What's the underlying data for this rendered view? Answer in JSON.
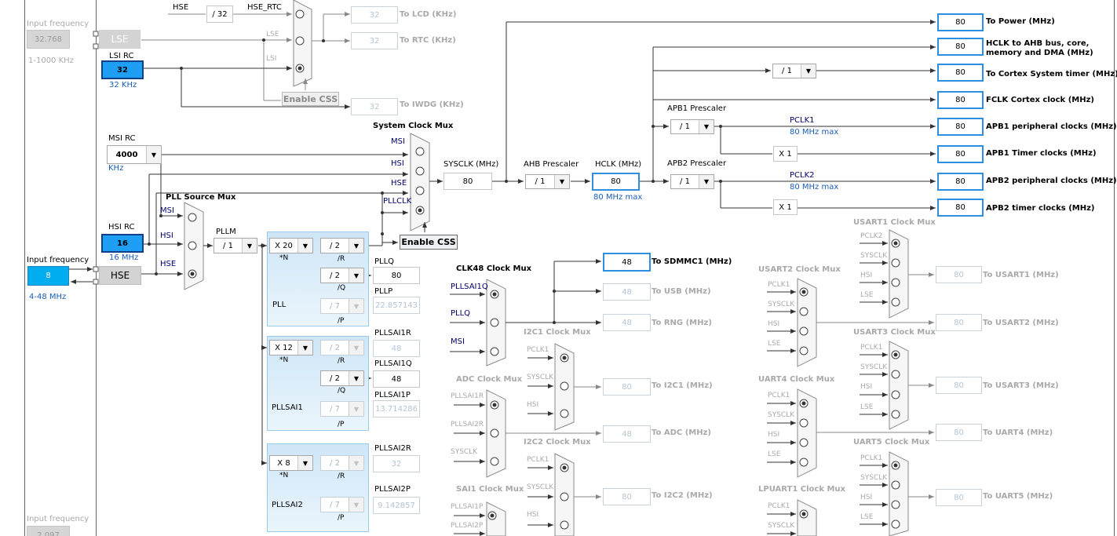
{
  "left_panel": {
    "input_frequency_label": "Input frequency",
    "lse_input_value": "32.768",
    "lse_range": "1-1000 KHz",
    "lse_label": "LSE",
    "lsi_label": "LSI RC",
    "lsi_value": "32",
    "lsi_unit": "32 KHz",
    "msi_label": "MSI RC",
    "msi_value": "4000",
    "msi_unit": "KHz",
    "hsi_label": "HSI RC",
    "hsi_value": "16",
    "hsi_unit": "16 MHz",
    "hse_input_value": "8",
    "hse_range": "4-48 MHz",
    "hse_label": "HSE",
    "bottom_input_value": "2.097"
  },
  "rtc": {
    "hse_label": "HSE",
    "hse_div": "/ 32",
    "hse_rtc_label": "HSE_RTC",
    "lse_label": "LSE",
    "lsi_label": "LSI",
    "enable_css": "Enable CSS",
    "lcd_value": "32",
    "lcd_label": "To LCD (KHz)",
    "rtc_value": "32",
    "rtc_label": "To RTC (KHz)",
    "iwdg_value": "32",
    "iwdg_label": "To IWDG (KHz)"
  },
  "system": {
    "mux_title": "System Clock Mux",
    "msi": "MSI",
    "hsi": "HSI",
    "hse": "HSE",
    "pllclk": "PLLCLK",
    "enable_css": "Enable CSS",
    "sysclk_label": "SYSCLK (MHz)",
    "sysclk_value": "80",
    "ahb_label": "AHB Prescaler",
    "ahb_value": "/ 1",
    "hclk_label": "HCLK (MHz)",
    "hclk_value": "80",
    "hclk_max": "80 MHz max",
    "cortex_div": "/ 1",
    "apb1_label": "APB1 Prescaler",
    "apb1_value": "/ 1",
    "pclk1_label": "PCLK1",
    "pclk1_max": "80 MHz max",
    "apb1_timer_mult": "X 1",
    "apb2_label": "APB2 Prescaler",
    "apb2_value": "/ 1",
    "pclk2_label": "PCLK2",
    "pclk2_max": "80 MHz max",
    "apb2_timer_mult": "X 1"
  },
  "outputs": [
    {
      "value": "80",
      "label": "To Power (MHz)"
    },
    {
      "value": "80",
      "label": "HCLK to AHB bus, core,",
      "label2": "memory and DMA (MHz)"
    },
    {
      "value": "80",
      "label": "To Cortex System timer (MHz)"
    },
    {
      "value": "80",
      "label": "FCLK Cortex clock (MHz)"
    },
    {
      "value": "80",
      "label": "APB1 peripheral clocks (MHz)"
    },
    {
      "value": "80",
      "label": "APB1 Timer clocks (MHz)"
    },
    {
      "value": "80",
      "label": "APB2 peripheral clocks (MHz)"
    },
    {
      "value": "80",
      "label": "APB2 timer clocks (MHz)"
    }
  ],
  "pll": {
    "source_mux_title": "PLL Source Mux",
    "msi": "MSI",
    "hsi": "HSI",
    "hse": "HSE",
    "pllm_label": "PLLM",
    "pllm_value": "/ 1",
    "main": {
      "n": "X 20",
      "n_label": "*N",
      "r": "/ 2",
      "r_label": "/R",
      "q": "/ 2",
      "q_label": "/Q",
      "p": "/ 7",
      "p_label": "/P",
      "name": "PLL",
      "pllq_label": "PLLQ",
      "pllq_value": "80",
      "pllp_label": "PLLP",
      "pllp_value": "22.857143"
    },
    "sai1": {
      "n": "X 12",
      "n_label": "*N",
      "r": "/ 2",
      "r_label": "/R",
      "q": "/ 2",
      "q_label": "/Q",
      "p": "/ 7",
      "p_label": "/P",
      "name": "PLLSAI1",
      "r_out_label": "PLLSAI1R",
      "r_out_value": "48",
      "q_out_label": "PLLSAI1Q",
      "q_out_value": "48",
      "p_out_label": "PLLSAI1P",
      "p_out_value": "13.714286"
    },
    "sai2": {
      "n": "X 8",
      "n_label": "*N",
      "r": "/ 2",
      "r_label": "/R",
      "p": "/ 7",
      "p_label": "/P",
      "name": "PLLSAI2",
      "r_out_label": "PLLSAI2R",
      "r_out_value": "32",
      "p_out_label": "PLLSAI2P",
      "p_out_value": "9.142857"
    }
  },
  "clk48": {
    "title": "CLK48 Clock Mux",
    "in1": "PLLSAI1Q",
    "in2": "PLLQ",
    "in3": "MSI",
    "sdmmc_value": "48",
    "sdmmc_label": "To SDMMC1 (MHz)",
    "usb_value": "48",
    "usb_label": "To USB (MHz)",
    "rng_value": "48",
    "rng_label": "To RNG (MHz)"
  },
  "i2c1": {
    "title": "I2C1 Clock Mux",
    "in1": "PCLK1",
    "in2": "SYSCLK",
    "in3": "HSI",
    "value": "80",
    "label": "To I2C1 (MHz)"
  },
  "adc": {
    "title": "ADC Clock Mux",
    "in1": "PLLSAI1R",
    "in2": "PLLSAI2R",
    "in3": "SYSCLK",
    "value": "48",
    "label": "To ADC (MHz)"
  },
  "i2c2": {
    "title": "I2C2 Clock Mux",
    "in1": "PCLK1",
    "in2": "SYSCLK",
    "in3": "HSI",
    "value": "80",
    "label": "To I2C2 (MHz)"
  },
  "sai1": {
    "title": "SAI1 Clock Mux",
    "in1": "PLLSAI1P",
    "in2": "PLLSAI2P"
  },
  "usart1": {
    "title": "USART1 Clock Mux",
    "in1": "PCLK2",
    "in2": "SYSCLK",
    "in3": "HSI",
    "in4": "LSE",
    "value": "80",
    "label": "To USART1 (MHz)"
  },
  "usart2": {
    "title": "USART2 Clock Mux",
    "in1": "PCLK1",
    "in2": "SYSCLK",
    "in3": "HSI",
    "in4": "LSE",
    "value": "80",
    "label": "To USART2 (MHz)"
  },
  "usart3": {
    "title": "USART3 Clock Mux",
    "in1": "PCLK1",
    "in2": "SYSCLK",
    "in3": "HSI",
    "in4": "LSE",
    "value": "80",
    "label": "To USART3 (MHz)"
  },
  "uart4": {
    "title": "UART4 Clock Mux",
    "in1": "PCLK1",
    "in2": "SYSCLK",
    "in3": "HSI",
    "in4": "LSE",
    "value": "80",
    "label": "To UART4 (MHz)"
  },
  "uart5": {
    "title": "UART5 Clock Mux",
    "in1": "PCLK1",
    "in2": "SYSCLK",
    "in3": "HSI",
    "in4": "LSE",
    "value": "80",
    "label": "To UART5 (MHz)"
  },
  "lpuart1": {
    "title": "LPUART1 Clock Mux",
    "in1": "PCLK1",
    "in2": "SYSCLK"
  },
  "icons": {
    "dropdown_arrow": "chevron-down-icon",
    "radio": "radio-icon",
    "mux": "mux-icon"
  }
}
